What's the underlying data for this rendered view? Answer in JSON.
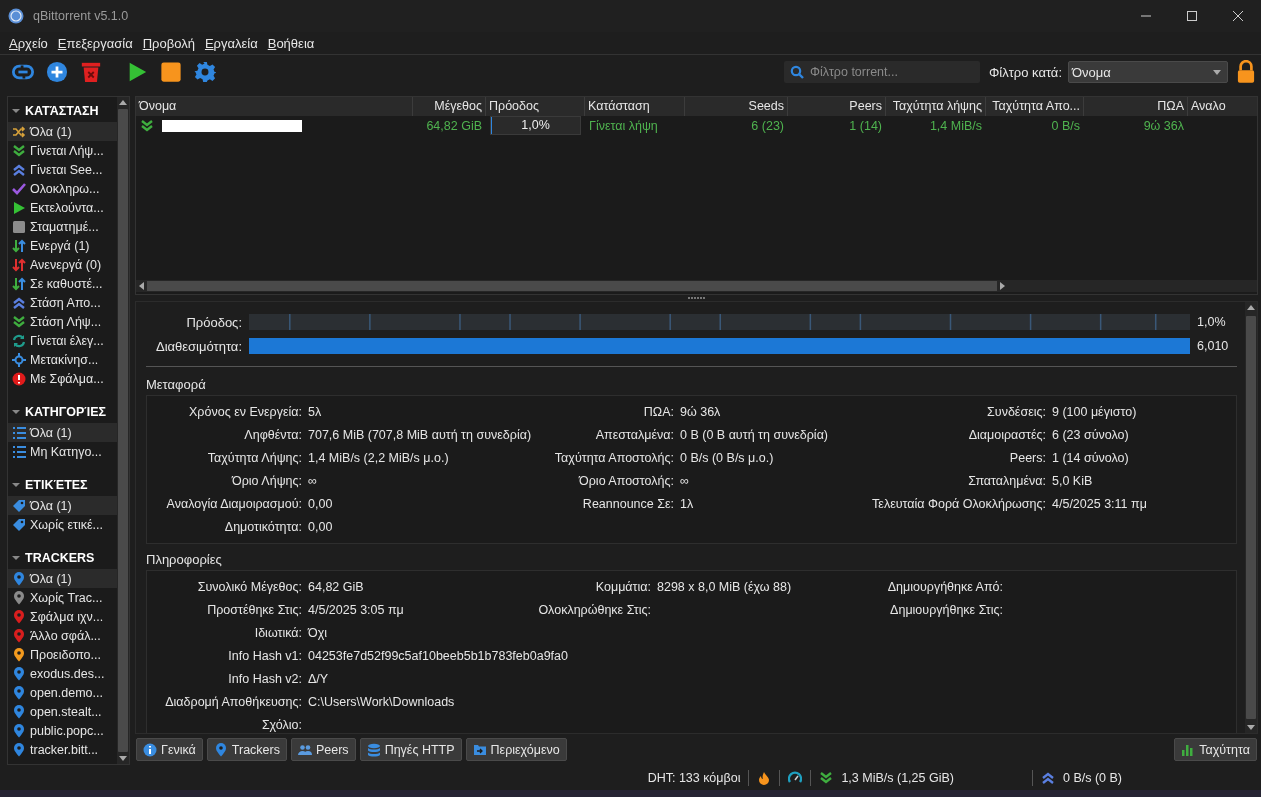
{
  "window": {
    "title": "qBittorrent v5.1.0"
  },
  "menu": [
    "Αρχείο",
    "Επεξεργασία",
    "Προβολή",
    "Εργαλεία",
    "Βοήθεια"
  ],
  "toolbar": {
    "buttons": [
      {
        "kind": "link"
      },
      {
        "kind": "add"
      },
      {
        "kind": "delete"
      },
      {
        "kind": "start"
      },
      {
        "kind": "stop"
      },
      {
        "kind": "settings"
      }
    ],
    "search": {
      "placeholder": "Φίλτρο torrent..."
    },
    "filter_label": "Φίλτρο κατά:",
    "filter_value": "Όνομα",
    "locked": true
  },
  "sidebar": [
    {
      "title": "ΚΑΤΆΣΤΑΣΗ",
      "expanded": true,
      "items": [
        {
          "label": "Όλα (1)",
          "kind": "shuffle",
          "selected": true
        },
        {
          "label": "Γίνεται Λήψ...",
          "kind": "down",
          "selected": false
        },
        {
          "label": "Γίνεται See...",
          "kind": "up",
          "selected": false
        },
        {
          "label": "Ολοκληρω...",
          "kind": "check",
          "selected": false
        },
        {
          "label": "Εκτελούντα...",
          "kind": "play",
          "selected": false
        },
        {
          "label": "Σταματημέ...",
          "kind": "stopped",
          "selected": false
        },
        {
          "label": "Ενεργά (1)",
          "kind": "active",
          "selected": false
        },
        {
          "label": "Ανενεργά (0)",
          "kind": "inactive",
          "selected": false
        },
        {
          "label": "Σε καθυστέ...",
          "kind": "stalled",
          "selected": false
        },
        {
          "label": "Στάση Απο...",
          "kind": "up",
          "selected": false
        },
        {
          "label": "Στάση Λήψ...",
          "kind": "down",
          "selected": false
        },
        {
          "label": "Γίνεται έλεγ...",
          "kind": "checking",
          "selected": false
        },
        {
          "label": "Μετακίνησ...",
          "kind": "moving",
          "selected": false
        },
        {
          "label": "Με Σφάλμα...",
          "kind": "error",
          "selected": false
        }
      ]
    },
    {
      "title": "ΚΑΤΗΓΟΡΊΕΣ",
      "expanded": true,
      "items": [
        {
          "label": "Όλα (1)",
          "kind": "list",
          "selected": true
        },
        {
          "label": "Μη Κατηγο...",
          "kind": "list",
          "selected": false
        }
      ]
    },
    {
      "title": "ΕΤΙΚΈΤΕΣ",
      "expanded": true,
      "items": [
        {
          "label": "Όλα (1)",
          "kind": "tag",
          "selected": true
        },
        {
          "label": "Χωρίς ετικέ...",
          "kind": "tag",
          "selected": false
        }
      ]
    },
    {
      "title": "TRACKERS",
      "expanded": true,
      "items": [
        {
          "label": "Όλα (1)",
          "kind": "pin",
          "color": "#2f86df",
          "selected": true
        },
        {
          "label": "Χωρίς Trac...",
          "kind": "pin",
          "color": "#8a8a8a",
          "selected": false
        },
        {
          "label": "Σφάλμα ιχν...",
          "kind": "pin",
          "color": "#d91e1e",
          "selected": false
        },
        {
          "label": "Άλλο σφάλ...",
          "kind": "pin",
          "color": "#d91e1e",
          "selected": false
        },
        {
          "label": "Προειδοπο...",
          "kind": "pin",
          "color": "#f39a1e",
          "selected": false
        },
        {
          "label": "exodus.des...",
          "kind": "pin",
          "color": "#2f86df",
          "selected": false
        },
        {
          "label": "open.demo...",
          "kind": "pin",
          "color": "#2f86df",
          "selected": false
        },
        {
          "label": "open.stealt...",
          "kind": "pin",
          "color": "#2f86df",
          "selected": false
        },
        {
          "label": "public.popc...",
          "kind": "pin",
          "color": "#2f86df",
          "selected": false
        },
        {
          "label": "tracker.bitt...",
          "kind": "pin",
          "color": "#2f86df",
          "selected": false
        }
      ]
    }
  ],
  "torrents": {
    "columns": [
      "Όνομα",
      "Μέγεθος",
      "Πρόοδος",
      "Κατάσταση",
      "Seeds",
      "Peers",
      "Ταχύτητα λήψης",
      "Ταχύτητα Απο...",
      "ΠΩΑ",
      "Αναλο"
    ],
    "rows": [
      {
        "kind": "down",
        "name_redacted": true,
        "size": "64,82 GiB",
        "progress": {
          "level": 0.01,
          "text": "1,0%"
        },
        "status": "Γίνεται λήψη",
        "seeds": "6 (23)",
        "peers": "1 (14)",
        "down_speed": "1,4 MiB/s",
        "up_speed": "0 B/s",
        "eta": "9ώ 36λ"
      }
    ]
  },
  "details": {
    "progress": {
      "label": "Πρόοδος:",
      "value": "1,0%"
    },
    "availability": {
      "label": "Διαθεσιμότητα:",
      "value": "6,010",
      "level": 1
    },
    "sections": [
      {
        "title": "Μεταφορά",
        "rows": [
          [
            {
              "label": "Χρόνος εν Ενεργεία:",
              "value": "5λ"
            },
            {
              "label": "ΠΩΑ:",
              "value": "9ώ 36λ"
            },
            {
              "label": "Συνδέσεις:",
              "value": "9 (100 μέγιστο)"
            }
          ],
          [
            {
              "label": "Ληφθέντα:",
              "value": "707,6 MiB (707,8 MiB αυτή τη συνεδρία)"
            },
            {
              "label": "Απεσταλμένα:",
              "value": "0 B (0 B αυτή τη συνεδρία)"
            },
            {
              "label": "Διαμοιραστές:",
              "value": "6 (23 σύνολο)"
            }
          ],
          [
            {
              "label": "Ταχύτητα Λήψης:",
              "value": "1,4 MiB/s (2,2 MiB/s μ.ο.)"
            },
            {
              "label": "Ταχύτητα Αποστολής:",
              "value": "0 B/s (0 B/s μ.ο.)"
            },
            {
              "label": "Peers:",
              "value": "1 (14 σύνολο)"
            }
          ],
          [
            {
              "label": "Όριο Λήψης:",
              "value": "∞"
            },
            {
              "label": "Όριο Αποστολής:",
              "value": "∞"
            },
            {
              "label": "Σπαταλημένα:",
              "value": "5,0 KiB"
            }
          ],
          [
            {
              "label": "Αναλογία Διαμοιρασμού:",
              "value": "0,00"
            },
            {
              "label": "Reannounce Σε:",
              "value": "1λ"
            },
            {
              "label": "Τελευταία Φορά Ολοκλήρωσης:",
              "value": "4/5/2025 3:11 πμ"
            }
          ],
          [
            {
              "label": "Δημοτικότητα:",
              "value": "0,00"
            }
          ]
        ]
      },
      {
        "title": "Πληροφορίες",
        "rows": [
          [
            {
              "label": "Συνολικό Μέγεθος:",
              "value": "64,82 GiB"
            },
            {
              "label": "Κομμάτια:",
              "value": "8298 x 8,0 MiB (έχω 88)"
            },
            {
              "label": "Δημιουργήθηκε Από:"
            }
          ],
          [
            {
              "label": "Προστέθηκε Στις:",
              "value": "4/5/2025 3:05 πμ"
            },
            {
              "label": "Ολοκληρώθηκε Στις:"
            },
            {
              "label": "Δημιουργήθηκε Στις:"
            }
          ],
          [
            {
              "label": "Ιδιωτικά:",
              "value": "Όχι"
            }
          ],
          [
            {
              "label": "Info Hash v1:",
              "value": "04253fe7d52f99c5af10beeb5b1b783feb0a9fa0"
            }
          ],
          [
            {
              "label": "Info Hash v2:",
              "value": "Δ/Υ"
            }
          ],
          [
            {
              "label": "Διαδρομή Αποθήκευσης:",
              "value": "C:\\Users\\Work\\Downloads"
            }
          ],
          [
            {
              "label": "Σχόλιο:"
            }
          ]
        ]
      }
    ]
  },
  "tabs": [
    {
      "label": "Γενικά",
      "kind": "info"
    },
    {
      "label": "Trackers",
      "kind": "pin"
    },
    {
      "label": "Peers",
      "kind": "people"
    },
    {
      "label": "Πηγές HTTP",
      "kind": "db"
    },
    {
      "label": "Περιεχόμενο",
      "kind": "folder"
    }
  ],
  "speed_tab": {
    "label": "Ταχύτητα",
    "kind": "chart"
  },
  "status_bar": {
    "dht": "DHT: 133 κόμβοι",
    "download": "1,3 MiB/s (1,25 GiB)",
    "upload": "0 B/s (0 B)"
  }
}
